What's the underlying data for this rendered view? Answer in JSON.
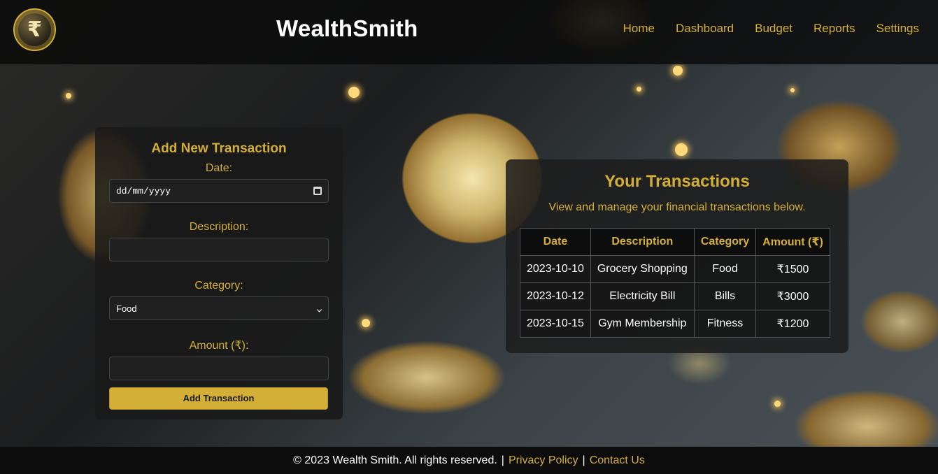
{
  "header": {
    "logo_symbol": "₹",
    "brand": "WealthSmith",
    "nav": [
      "Home",
      "Dashboard",
      "Budget",
      "Reports",
      "Settings"
    ]
  },
  "form": {
    "title": "Add New Transaction",
    "date_label": "Date:",
    "date_placeholder": "dd/mm/yyyy",
    "description_label": "Description:",
    "description_value": "",
    "category_label": "Category:",
    "category_selected": "Food",
    "amount_label": "Amount (₹):",
    "amount_value": "",
    "submit_label": "Add Transaction"
  },
  "transactions": {
    "title": "Your Transactions",
    "subtitle": "View and manage your financial transactions below.",
    "columns": [
      "Date",
      "Description",
      "Category",
      "Amount (₹)"
    ],
    "rows": [
      [
        "2023-10-10",
        "Grocery Shopping",
        "Food",
        "₹1500"
      ],
      [
        "2023-10-12",
        "Electricity Bill",
        "Bills",
        "₹3000"
      ],
      [
        "2023-10-15",
        "Gym Membership",
        "Fitness",
        "₹1200"
      ]
    ]
  },
  "footer": {
    "copyright": "© 2023 Wealth Smith. All rights reserved.",
    "separator": "|",
    "privacy": "Privacy Policy",
    "contact": "Contact Us"
  },
  "colors": {
    "accent": "#d4af37",
    "panel": "#191919",
    "header": "#0a0a0a"
  }
}
